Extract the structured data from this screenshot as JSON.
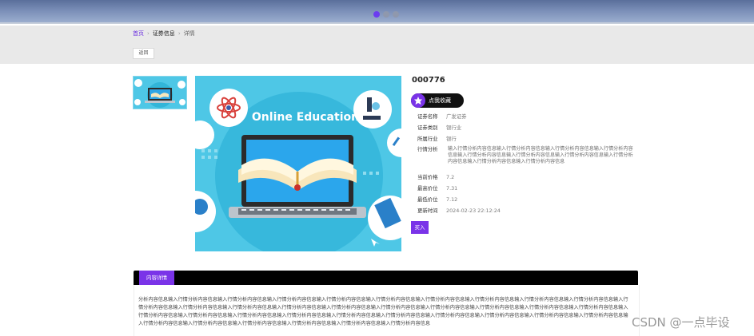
{
  "breadcrumb": {
    "items": [
      "首页",
      "证券信息",
      "详情"
    ]
  },
  "back_button": "返回",
  "stock": {
    "code": "000776",
    "favorite_label": "点我收藏",
    "fields": [
      {
        "key": "证券名称",
        "value": "广发证券"
      },
      {
        "key": "证券类别",
        "value": "银行业"
      },
      {
        "key": "所属行业",
        "value": "银行"
      }
    ],
    "description_label": "行情分析",
    "description": "输入行情分析内容信息输入行情分析内容信息输入行情分析内容信息输入行情分析内容信息输入行情分析内容信息输入行情分析内容信息输入行情分析内容信息输入行情分析内容信息输入行情分析内容信息输入行情分析内容信息",
    "prices": [
      {
        "key": "当前价格",
        "value": "7.2"
      },
      {
        "key": "最高价位",
        "value": "7.31"
      },
      {
        "key": "最低价位",
        "value": "7.12"
      },
      {
        "key": "更新时间",
        "value": "2024-02-23 22:12:24"
      }
    ],
    "buy_label": "买入"
  },
  "image_text": "Online Education",
  "content": {
    "tab_label": "内容详情",
    "text": "分析内容信息输入行情分析内容信息输入行情分析内容信息输入行情分析内容信息输入行情分析内容信息输入行情分析内容信息输入行情分析内容信息输入行情分析内容信息输入行情分析内容信息输入行情分析内容信息输入行情分析内容信息输入行情分析内容信息输入行情分析内容信息输入行情分析内容信息输入行情分析内容信息输入行情分析内容信息输入行情分析内容信息输入行情分析内容信息输入行情分析内容信息输入行情分析内容信息输入行情分析内容信息输入行情分析内容信息输入行情分析内容信息输入行情分析内容信息输入行情分析内容信息输入行情分析内容信息输入行情分析内容信息输入行情分析内容信息输入行情分析内容信息输入行情分析内容信息输入行情分析内容信息输入行情分析内容信息输入行情分析内容信息输入行情分析内容信息输入行情分析内容信息输入行情分析内容信息"
  },
  "watermark": "CSDN @一点毕设",
  "colors": {
    "accent": "#7a33e8",
    "banner": "#7b8fb8",
    "hero_bg": "#4ec7e6"
  }
}
